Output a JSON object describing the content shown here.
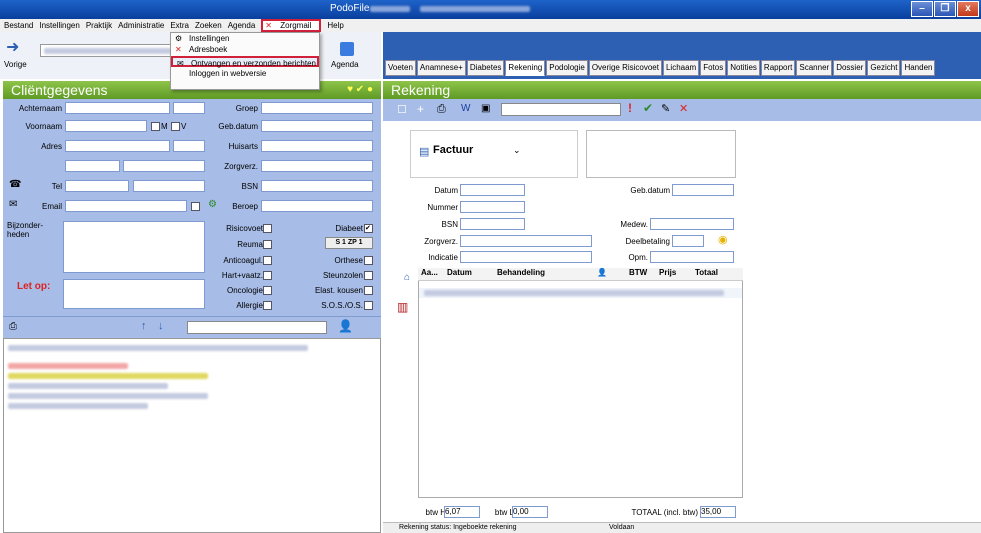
{
  "window": {
    "title": "PodoFile",
    "minimize": "–",
    "maximize": "❐",
    "close": "x"
  },
  "menu": {
    "items": [
      "Bestand",
      "Instellingen",
      "Praktijk",
      "Administratie",
      "Extra",
      "Zoeken",
      "Agenda"
    ],
    "zorgmail": "Zorgmail",
    "help": "Help"
  },
  "dropdown": {
    "items": [
      {
        "label": "Instellingen",
        "icon": "gear-icon"
      },
      {
        "label": "Adresboek",
        "icon": "x-icon"
      },
      {
        "label": "Ontvangen en verzonden berichten",
        "icon": "mail-icon"
      },
      {
        "label": "Inloggen in webversie",
        "icon": ""
      }
    ]
  },
  "lefttoolbar": {
    "back": "Vorige",
    "agenda": "Agenda"
  },
  "client": {
    "title": "Cliëntgegevens",
    "labels": {
      "achternaam": "Achternaam",
      "voornaam": "Voornaam",
      "adres": "Adres",
      "tel": "Tel",
      "email": "Email",
      "bijzonderheden": "Bijzonder-\nheden",
      "letop": "Let op:",
      "groep": "Groep",
      "gebdatum": "Geb.datum",
      "huisarts": "Huisarts",
      "zorgverz": "Zorgverz.",
      "bsn": "BSN",
      "beroep": "Beroep"
    },
    "gender": {
      "m": "M",
      "v": "V"
    },
    "checks": {
      "left": [
        "Risicovoet",
        "Reuma",
        "Anticoagul.",
        "Hart+vaatz.",
        "Oncologie",
        "Allergie"
      ],
      "right": [
        "Diabeet",
        "",
        "Orthese",
        "Steunzolen",
        "Elast. kousen",
        "S.O.S./O.S."
      ]
    },
    "s1zp": "S 1 ZP 1"
  },
  "tabs": [
    "Voeten",
    "Anamnese+",
    "Diabetes",
    "Rekening",
    "Podologie",
    "Overige Risicovoet",
    "Lichaam",
    "Fotos",
    "Notities",
    "Rapport",
    "Scanner",
    "Dossier",
    "Gezicht",
    "Handen"
  ],
  "rekening": {
    "title": "Rekening",
    "factuur": "Factuur",
    "labels": {
      "datum": "Datum",
      "nummer": "Nummer",
      "bsn": "BSN",
      "zorgverz": "Zorgverz.",
      "indicatie": "Indicatie",
      "gebdatum": "Geb.datum",
      "medew": "Medew.",
      "deelbetaling": "Deelbetaling",
      "opm": "Opm."
    },
    "columns": [
      "Aa...",
      "Datum",
      "Behandeling",
      "",
      "BTW",
      "Prijs",
      "Totaal"
    ],
    "btwh_label": "btw H",
    "btwh": "6,07",
    "btwl_label": "btw L",
    "btwl": "0,00",
    "totaal_label": "TOTAAL (incl. btw)",
    "totaal": "35,00",
    "status": "Rekening status: Ingeboekte rekening",
    "voldaan": "Voldaan"
  }
}
